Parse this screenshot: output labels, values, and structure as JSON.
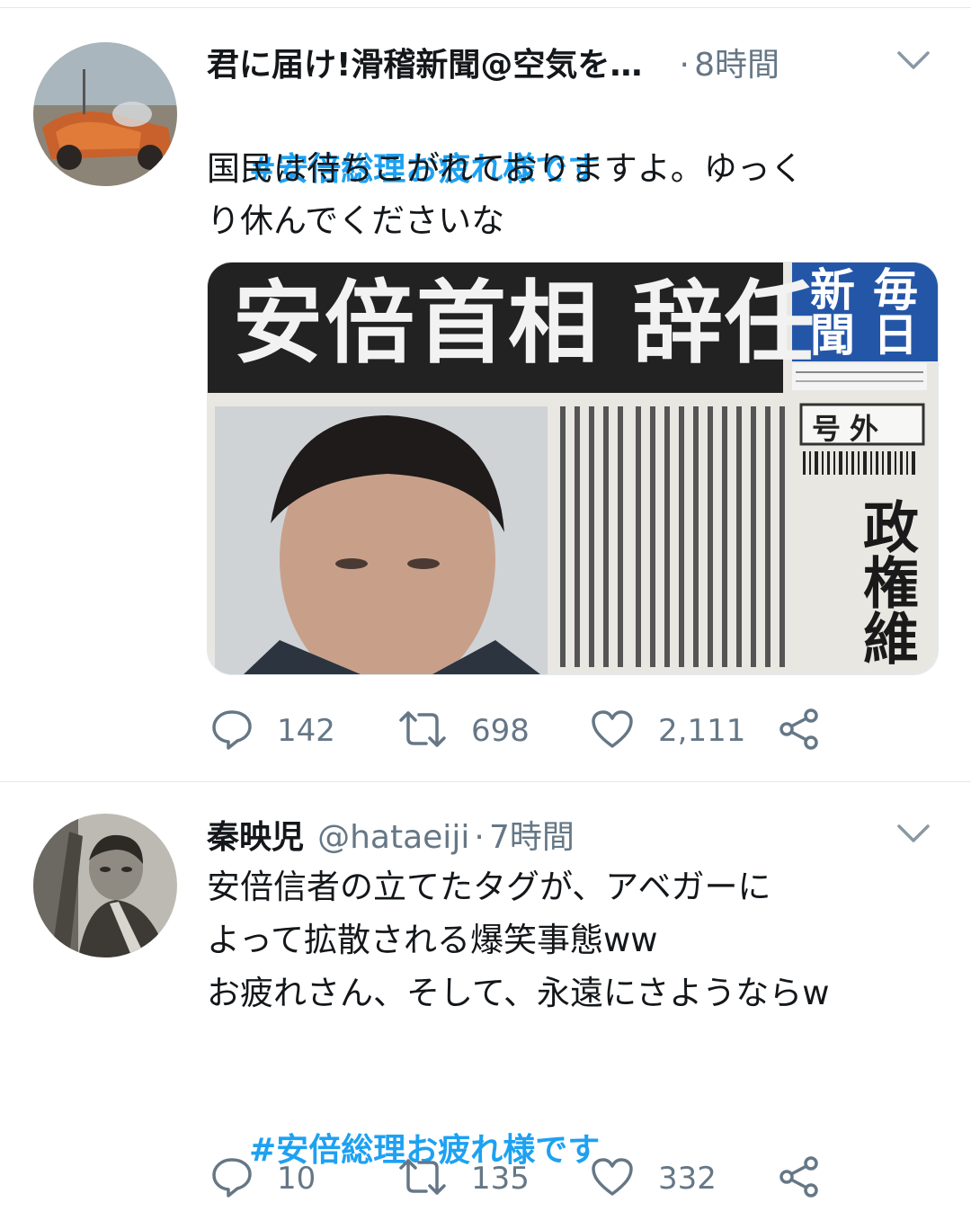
{
  "tweets": [
    {
      "name": "君に届け!滑稽新聞@空気を…",
      "handle": "",
      "separator": "·",
      "time": "8時間",
      "hashtag": "#安倍総理お疲れ様です",
      "lines": [
        "国民は待ちこがれておりますよ。ゆっく",
        "り休んでくださいな"
      ],
      "media": {
        "headline": "安倍首相 辞任",
        "masthead": [
          "毎",
          "新",
          "日",
          "聞"
        ],
        "extra": "号外",
        "subhead": "政権維"
      },
      "replies": "142",
      "retweets": "698",
      "likes": "2,111"
    },
    {
      "name": "秦映児",
      "handle": "@hataeiji",
      "separator": "·",
      "time": "7時間",
      "lines": [
        "安倍信者の立てたタグが、アベガーに",
        "よって拡散される爆笑事態ww",
        "お疲れさん、そして、永遠にさようならw"
      ],
      "hashtag": "#安倍総理お疲れ様です",
      "replies": "10",
      "retweets": "135",
      "likes": "332"
    }
  ],
  "icons": {
    "reply": "reply-icon",
    "retweet": "retweet-icon",
    "like": "heart-icon",
    "share": "share-icon",
    "caret": "chevron-down-icon"
  },
  "colors": {
    "hashtag": "#1da1f2",
    "secondary_text": "#657786",
    "divider": "#e1e8ed"
  }
}
